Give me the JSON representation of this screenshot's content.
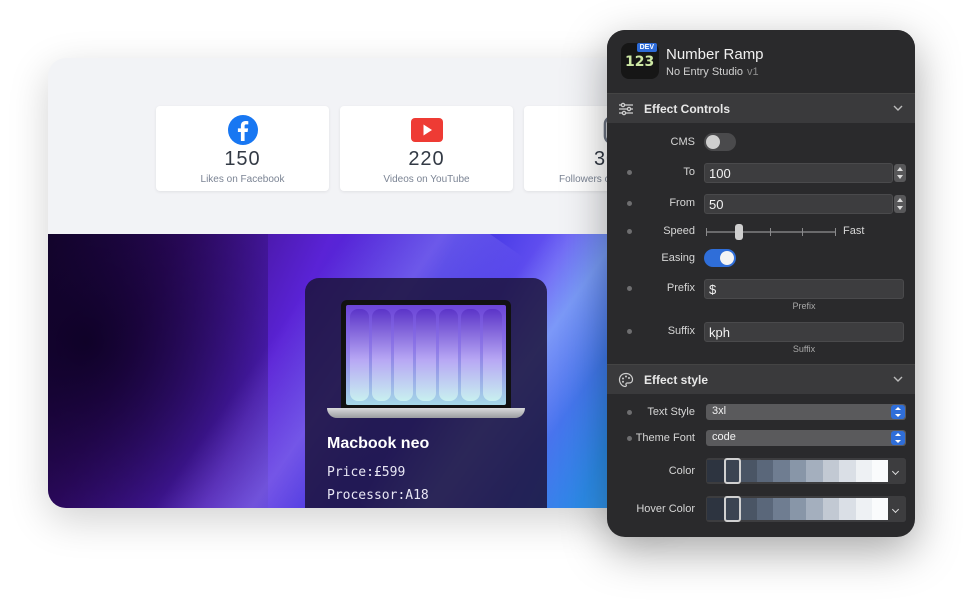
{
  "site": {
    "stats": [
      {
        "value": "150",
        "label": "Likes on Facebook",
        "icon": "facebook-icon",
        "color": "#1877f2"
      },
      {
        "value": "220",
        "label": "Videos on YouTube",
        "icon": "youtube-icon",
        "color": "#ee3b34"
      },
      {
        "value": "30",
        "label": "Followers o",
        "icon": "instagram-icon",
        "color": "#6b7280"
      }
    ],
    "product": {
      "name": "Macbook neo",
      "price": "Price:£599",
      "processor": "Processor:A18"
    }
  },
  "panel": {
    "badge": "DEV",
    "icon_number": "123",
    "title": "Number Ramp",
    "subtitle": "No Entry Studio",
    "version": "v1",
    "effect_controls": {
      "title": "Effect Controls",
      "cms_label": "CMS",
      "cms_on": false,
      "to_label": "To",
      "to_value": "100",
      "from_label": "From",
      "from_value": "50",
      "speed_label": "Speed",
      "speed_end_label": "Fast",
      "speed_level": 0.25,
      "easing_label": "Easing",
      "easing_on": true,
      "prefix_label": "Prefix",
      "prefix_value": "$",
      "prefix_hint": "Prefix",
      "suffix_label": "Suffix",
      "suffix_value": "kph",
      "suffix_hint": "Suffix"
    },
    "effect_style": {
      "title": "Effect style",
      "text_style_label": "Text Style",
      "text_style_value": "3xl",
      "theme_font_label": "Theme Font",
      "theme_font_value": "code",
      "color_label": "Color",
      "hover_color_label": "Hover Color",
      "swatches": [
        "#2d3440",
        "#3b4452",
        "#4a5565",
        "#5a677a",
        "#6f7d91",
        "#8896a8",
        "#a4afbe",
        "#c2c9d3",
        "#dadfe6",
        "#eef1f4",
        "#fafbfc"
      ]
    }
  }
}
